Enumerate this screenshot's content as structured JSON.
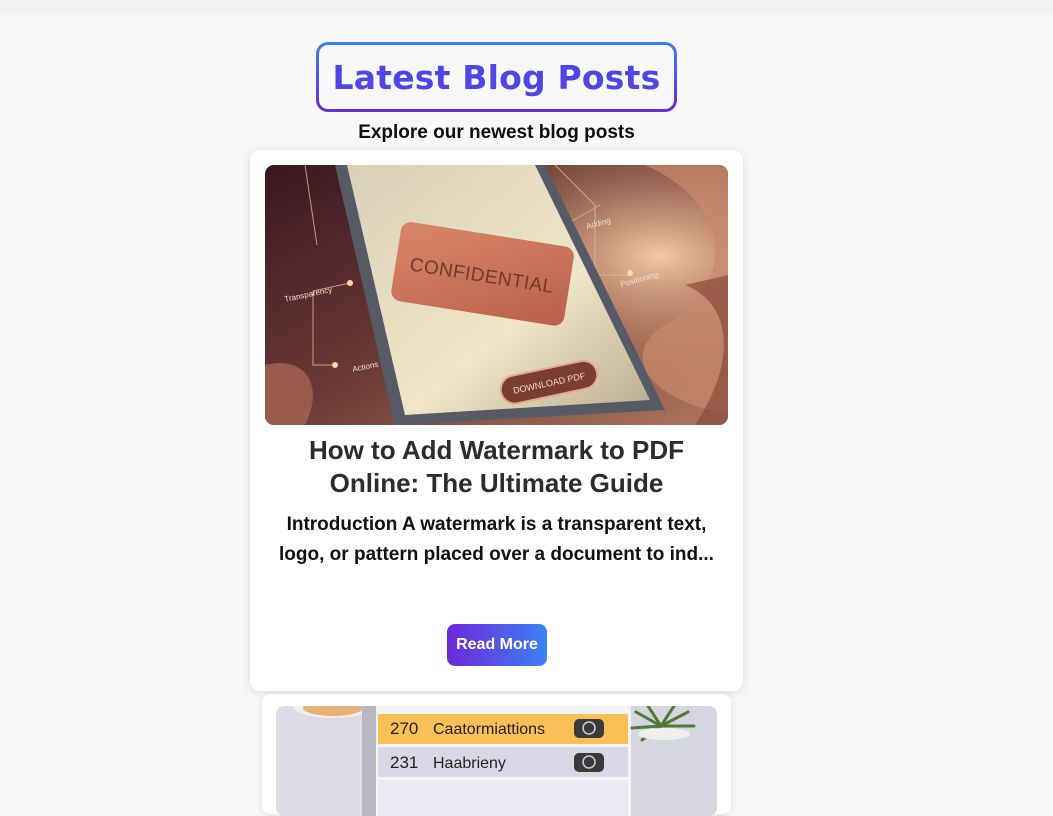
{
  "header": {
    "title": "Latest Blog Posts",
    "subtitle": "Explore our newest blog posts"
  },
  "posts": [
    {
      "title": "How to Add Watermark to PDF Online: The Ultimate Guide",
      "excerpt": "Introduction A watermark is a transparent text, logo, or pattern placed over a document to ind...",
      "read_more_label": "Read More",
      "image": {
        "icon": "watermark-pdf-illustration",
        "stamp_text": "CONFIDENTIAL",
        "button_text": "DOWNLOAD PDF",
        "labels": [
          "Adding",
          "Positioning",
          "Transparency",
          "Actions"
        ]
      }
    },
    {
      "image": {
        "icon": "list-illustration",
        "rows": [
          {
            "num": "270",
            "label": "Caatormiattions"
          },
          {
            "num": "231",
            "label": "Haabrieny"
          }
        ]
      }
    }
  ],
  "colors": {
    "accent": "#4f46e5",
    "gradient_start": "#6d28d9",
    "gradient_end": "#3b82f6"
  }
}
